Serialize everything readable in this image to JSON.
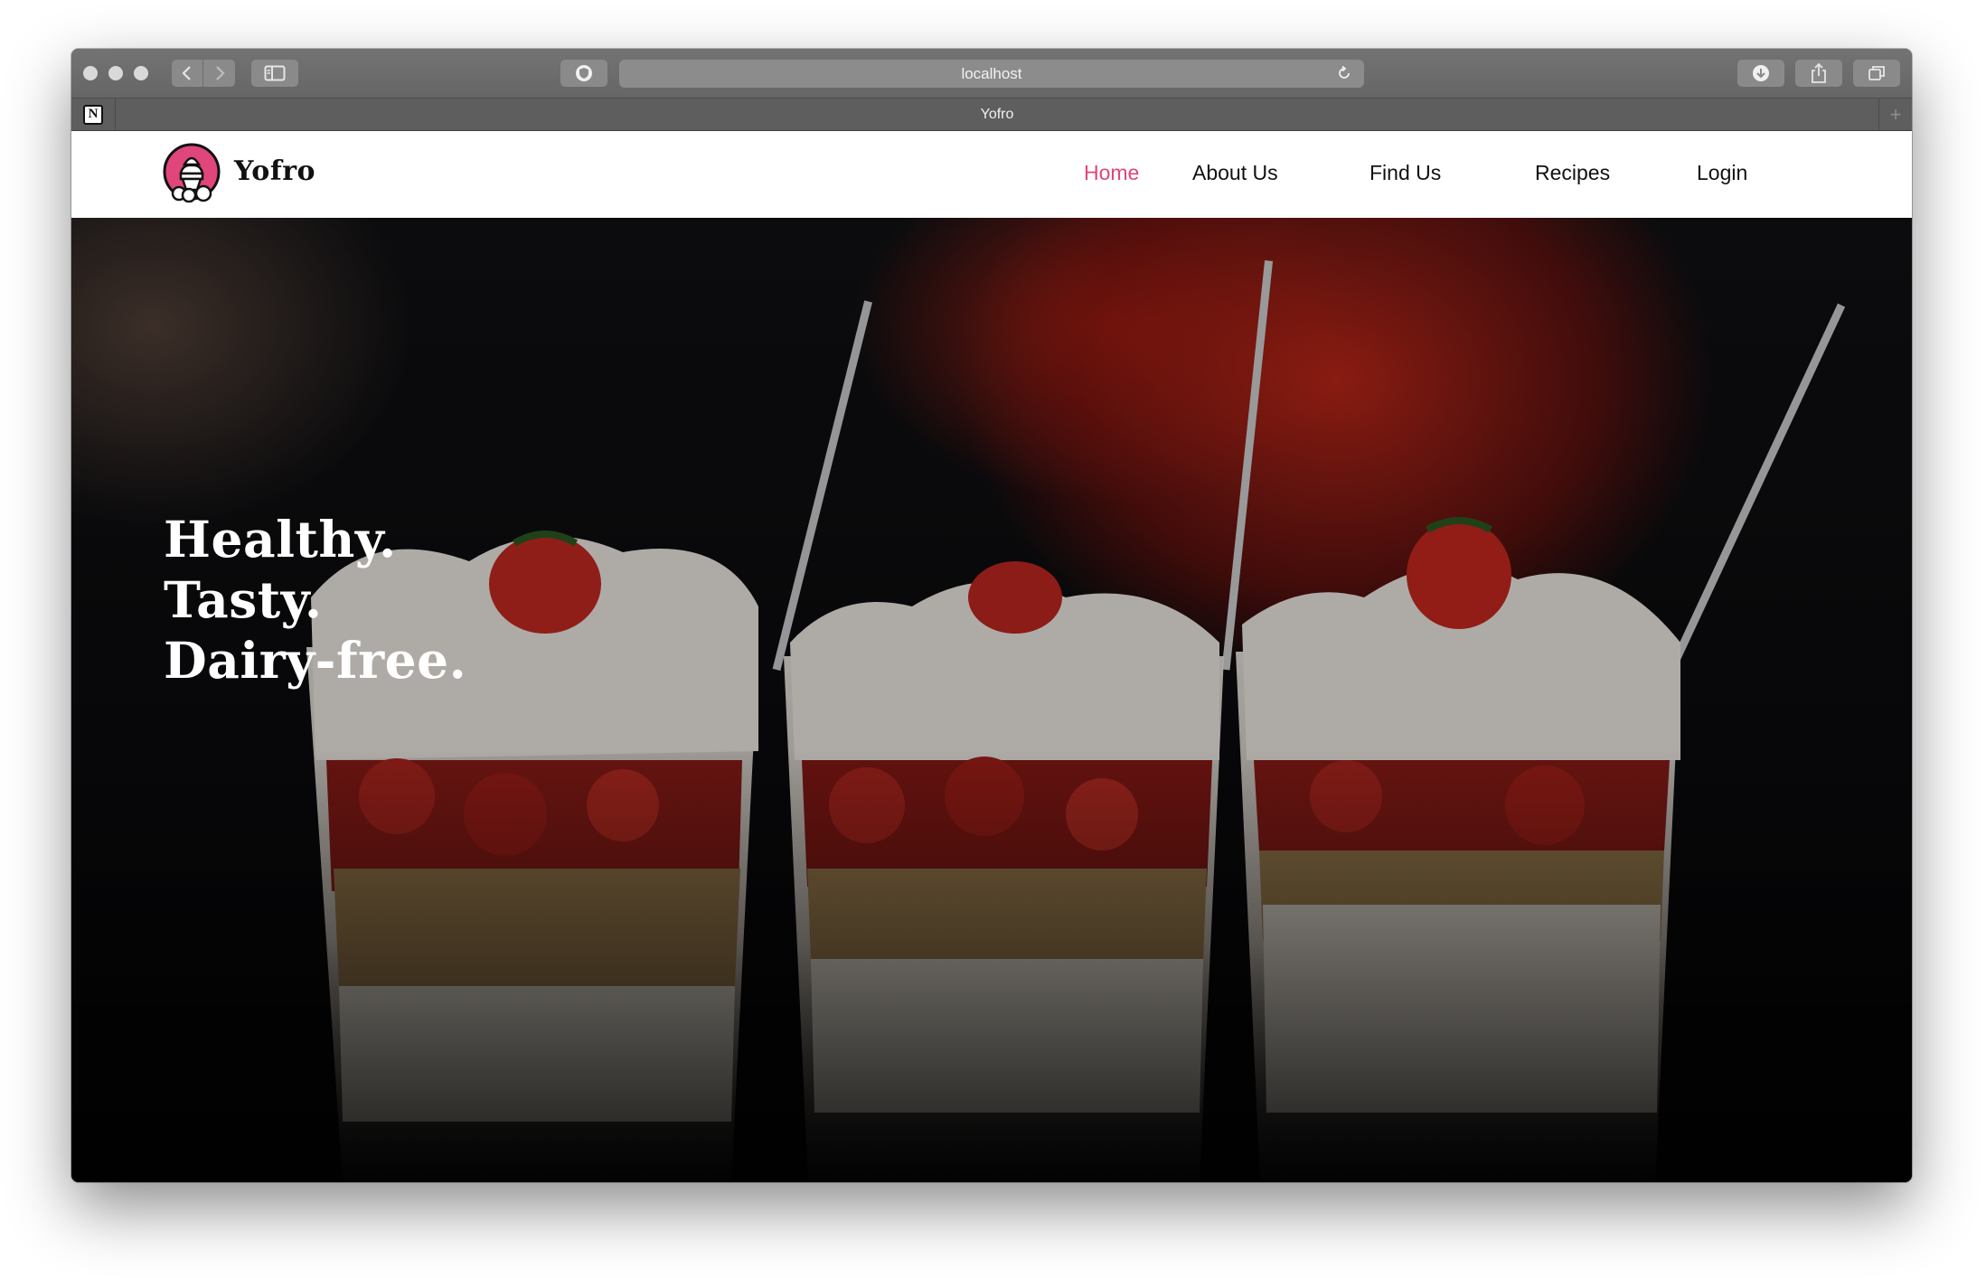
{
  "browser": {
    "url": "localhost",
    "tab_title": "Yofro",
    "new_tab_symbol": "+",
    "pinned_tab_letter": "N"
  },
  "site": {
    "brand": "Yofro",
    "accent_color": "#e0457b",
    "nav": {
      "home": "Home",
      "about": "About Us",
      "find": "Find Us",
      "recipes": "Recipes",
      "login": "Login"
    },
    "hero": {
      "line1": "Healthy.",
      "line2": "Tasty.",
      "line3": "Dairy-free."
    }
  },
  "icons": {
    "window_controls": [
      "close-icon",
      "minimize-icon",
      "zoom-icon"
    ],
    "toolbar": [
      "back-icon",
      "forward-icon",
      "sidebar-icon",
      "privacy-shield-icon",
      "reload-icon",
      "downloads-icon",
      "share-icon",
      "tabs-overview-icon"
    ]
  }
}
